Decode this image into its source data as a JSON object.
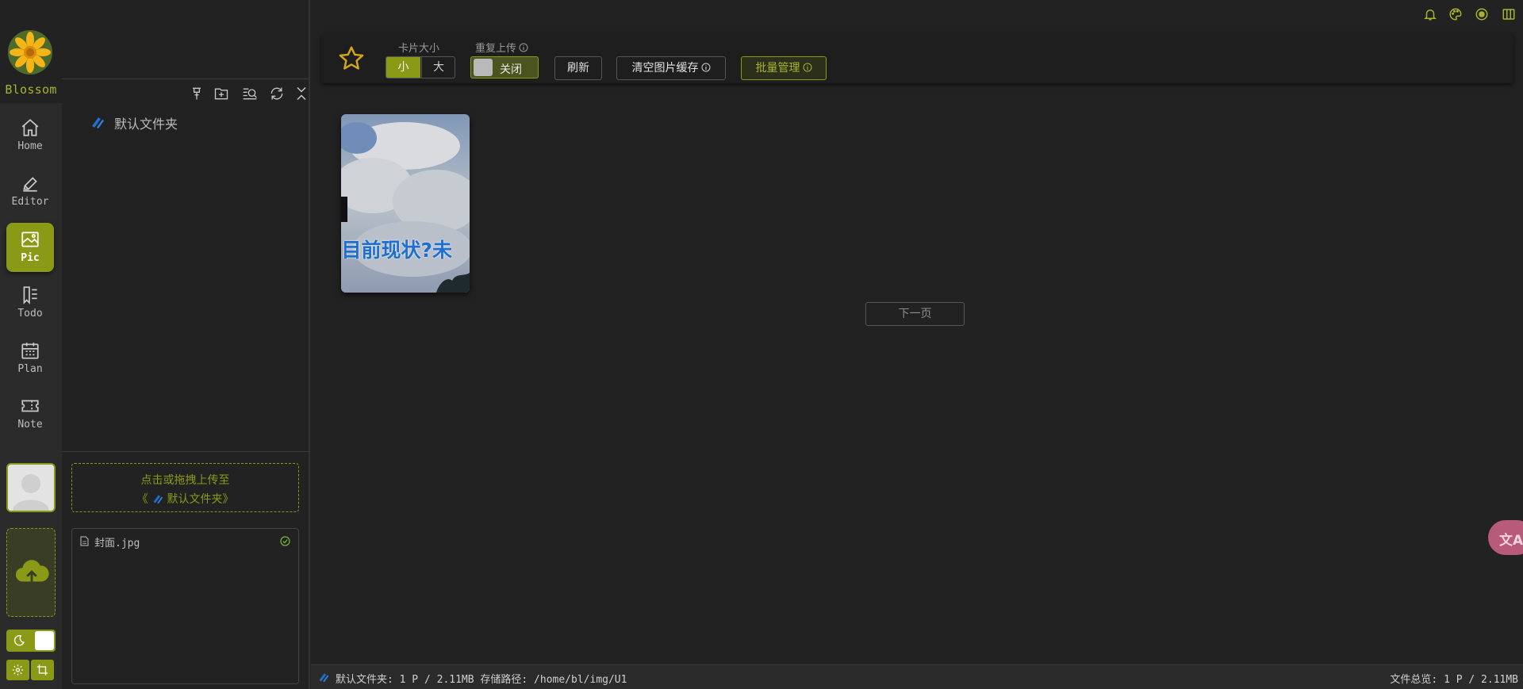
{
  "app": {
    "brand": "Blossom"
  },
  "nav": {
    "items": [
      {
        "label": "Home",
        "icon": "home-icon",
        "active": false
      },
      {
        "label": "Editor",
        "icon": "editor-icon",
        "active": false
      },
      {
        "label": "Pic",
        "icon": "picture-icon",
        "active": true
      },
      {
        "label": "Todo",
        "icon": "todo-icon",
        "active": false
      },
      {
        "label": "Plan",
        "icon": "calendar-icon",
        "active": false
      },
      {
        "label": "Note",
        "icon": "ticket-icon",
        "active": false
      }
    ]
  },
  "folders": {
    "tools": [
      "pin-icon",
      "new-folder-icon",
      "search-list-icon",
      "refresh-icon",
      "collapse-icon"
    ],
    "items": [
      {
        "name": "默认文件夹"
      }
    ]
  },
  "upload": {
    "drop_line1": "点击或拖拽上传至",
    "drop_prefix": "《",
    "drop_folder": "默认文件夹",
    "drop_suffix": "》",
    "files": [
      {
        "name": "封面.jpg",
        "status": "success"
      }
    ]
  },
  "toolbar": {
    "card_size_label": "卡片大小",
    "size_small": "小",
    "size_large": "大",
    "repeat_label": "重复上传",
    "repeat_state": "关闭",
    "refresh": "刷新",
    "clear_cache": "清空图片缓存",
    "batch": "批量管理"
  },
  "gallery": {
    "cards": [
      {
        "caption": "?目前现状?未"
      }
    ],
    "next_page": "下一页"
  },
  "status": {
    "left": "默认文件夹: 1 P / 2.11MB  存储路径: /home/bl/img/U1",
    "right": "文件总览: 1 P / 2.11MB"
  },
  "colors": {
    "accent": "#8a9a17",
    "accent_text": "#a8b32c",
    "background": "#222222",
    "panel": "#2b2b2b",
    "translate_fab": "#b85a79"
  }
}
